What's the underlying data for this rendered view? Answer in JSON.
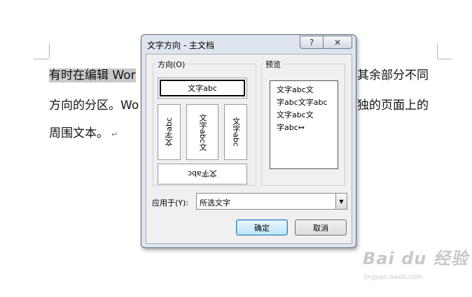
{
  "document": {
    "line1_left": "有时在编辑 Wor",
    "line1_right": "其余部分不同",
    "line2_left": "方向的分区。Wo",
    "line2_right": "独的页面上的",
    "line3": "周围文本。"
  },
  "dialog": {
    "title": "文字方向 - 主文档",
    "help_glyph": "?",
    "close_glyph": "✕",
    "direction_label": "方向(O)",
    "preview_label": "预览",
    "options": {
      "horizontal": "文字abc",
      "vertical_a": "文字abc",
      "vertical_b": "文字abc文",
      "vertical_c": "文字abc",
      "rotated": "文字abc"
    },
    "preview_lines": [
      "文字abc文",
      "字abc文字abc",
      "文字abc文",
      "字abc↔"
    ],
    "apply_label": "应用于(Y):",
    "apply_value": "所选文字",
    "ok_label": "确定",
    "cancel_label": "取消"
  },
  "watermark": {
    "main": "Bai du 经验",
    "sub": "jingyan.baidu.com"
  }
}
